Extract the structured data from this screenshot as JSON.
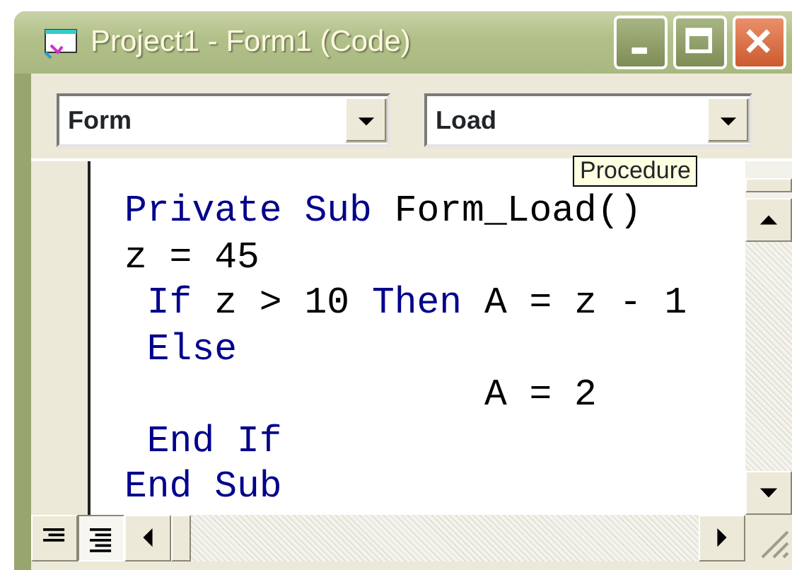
{
  "window": {
    "title": "Project1 - Form1 (Code)"
  },
  "object_combo": {
    "value": "Form"
  },
  "procedure_combo": {
    "value": "Load"
  },
  "tooltip": {
    "text": "Procedure"
  },
  "code_lines": [
    {
      "tokens": [
        {
          "kind": "keyword",
          "text": "Private Sub"
        },
        {
          "kind": "plain",
          "text": " Form_Load()"
        }
      ]
    },
    {
      "tokens": [
        {
          "kind": "plain",
          "text": "z = 45"
        }
      ]
    },
    {
      "tokens": [
        {
          "kind": "keyword",
          "text": " If"
        },
        {
          "kind": "plain",
          "text": " z > 10 "
        },
        {
          "kind": "keyword",
          "text": "Then"
        },
        {
          "kind": "plain",
          "text": " A = z - 1"
        }
      ]
    },
    {
      "tokens": [
        {
          "kind": "keyword",
          "text": " Else"
        }
      ]
    },
    {
      "tokens": [
        {
          "kind": "plain",
          "text": "                A = 2"
        }
      ]
    },
    {
      "tokens": [
        {
          "kind": "keyword",
          "text": " End If"
        }
      ]
    },
    {
      "tokens": [
        {
          "kind": "keyword",
          "text": "End Sub"
        }
      ]
    }
  ],
  "view_buttons": [
    {
      "kind": "procedure",
      "selected": false
    },
    {
      "kind": "module",
      "selected": true
    }
  ]
}
